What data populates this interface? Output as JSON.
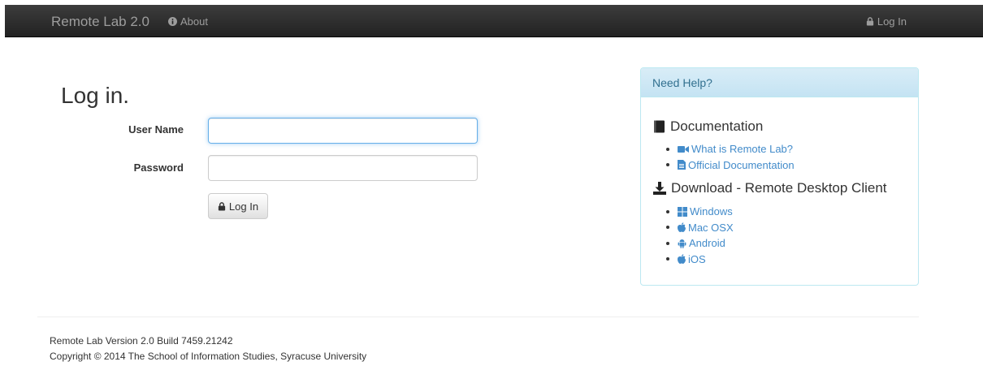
{
  "navbar": {
    "brand": "Remote Lab 2.0",
    "about": "About",
    "login": "Log In",
    "bg_color": "#222222"
  },
  "login_form": {
    "title": "Log in.",
    "username_label": "User Name",
    "username_value": "",
    "password_label": "Password",
    "password_value": "",
    "submit_label": "Log In"
  },
  "help_panel": {
    "heading": "Need Help?",
    "documentation": {
      "title": "Documentation",
      "links": [
        {
          "label": "What is Remote Lab?",
          "icon": "video-camera-icon"
        },
        {
          "label": "Official Documentation",
          "icon": "file-icon"
        }
      ]
    },
    "download": {
      "title": "Download - Remote Desktop Client",
      "links": [
        {
          "label": "Windows",
          "icon": "windows-icon"
        },
        {
          "label": "Mac OSX",
          "icon": "apple-icon"
        },
        {
          "label": "Android",
          "icon": "android-icon"
        },
        {
          "label": "iOS",
          "icon": "apple-icon"
        }
      ]
    },
    "accent_color": "#428bca"
  },
  "footer": {
    "version": "Remote Lab Version 2.0 Build 7459.21242",
    "copyright": "Copyright © 2014 The School of Information Studies, Syracuse University"
  }
}
